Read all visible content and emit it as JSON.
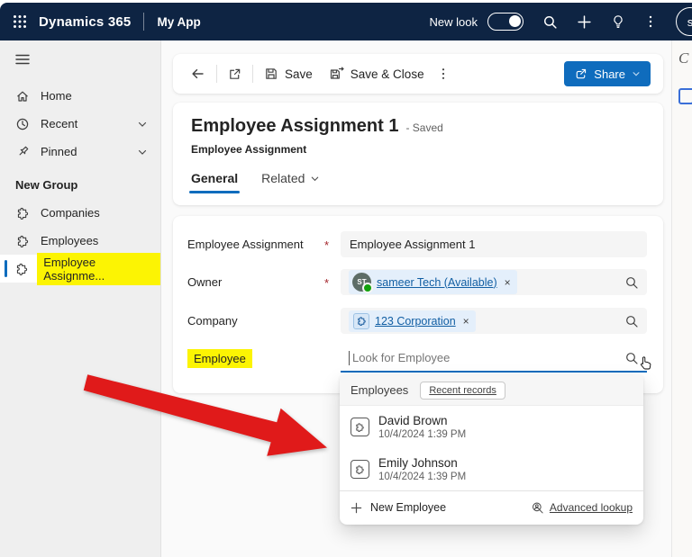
{
  "topbar": {
    "brand": "Dynamics 365",
    "app_name": "My App",
    "new_look_label": "New look",
    "new_look_state": "on",
    "user_initial": "s",
    "icons": [
      "waffle-icon",
      "search-icon",
      "add-icon",
      "lightbulb-icon",
      "more-vertical-icon",
      "avatar"
    ]
  },
  "sidebar": {
    "items": [
      {
        "label": "Home",
        "icon": "home-icon"
      },
      {
        "label": "Recent",
        "icon": "clock-icon",
        "expandable": true
      },
      {
        "label": "Pinned",
        "icon": "pin-icon",
        "expandable": true
      }
    ],
    "group_header": "New Group",
    "group_items": [
      {
        "label": "Companies",
        "icon": "entity-puzzle-icon"
      },
      {
        "label": "Employees",
        "icon": "entity-puzzle-icon"
      },
      {
        "label": "Employee Assignme...",
        "icon": "entity-puzzle-icon",
        "selected": true,
        "highlighted": true
      }
    ]
  },
  "command_bar": {
    "back_icon": "back-arrow-icon",
    "popout_icon": "open-in-new-window-icon",
    "save_label": "Save",
    "save_close_label": "Save & Close",
    "more_icon": "more-vertical-icon",
    "share_label": "Share"
  },
  "form": {
    "title": "Employee Assignment 1",
    "status": "- Saved",
    "entity": "Employee Assignment",
    "tabs": [
      "General",
      "Related"
    ],
    "required_marker": "*",
    "fields": [
      {
        "label": "Employee Assignment",
        "required": true,
        "value": "Employee Assignment 1"
      },
      {
        "label": "Owner",
        "required": true,
        "value": "sameer Tech (Available)",
        "avatar_initials": "ST",
        "presence": "available",
        "dismiss": "×"
      },
      {
        "label": "Company",
        "value": "123 Corporation",
        "dismiss": "×"
      },
      {
        "label": "Employee",
        "placeholder": "Look for Employee",
        "highlighted": true
      }
    ]
  },
  "lookup_flyout": {
    "header": "Employees",
    "recent_records_label": "Recent records",
    "items": [
      {
        "name": "David Brown",
        "date": "10/4/2024 1:39 PM"
      },
      {
        "name": "Emily Johnson",
        "date": "10/4/2024 1:39 PM"
      }
    ],
    "new_label": "New Employee",
    "advanced_label": "Advanced lookup"
  },
  "right_rail": {
    "icons": [
      "copilot-icon-partial",
      "panel-icon-partial"
    ]
  },
  "annotations": {
    "arrow": "red-arrow-pointing-to-lookup-flyout"
  },
  "colors": {
    "topbar_navy": "#0e2443",
    "accent_blue": "#0f6cbd",
    "link_blue": "#115ea3",
    "highlight_yellow": "#fcf403",
    "arrow_red": "#e01a1a",
    "presence_green": "#13a10e",
    "sidebar_gray": "#efefef",
    "main_bg": "#fafafa"
  }
}
